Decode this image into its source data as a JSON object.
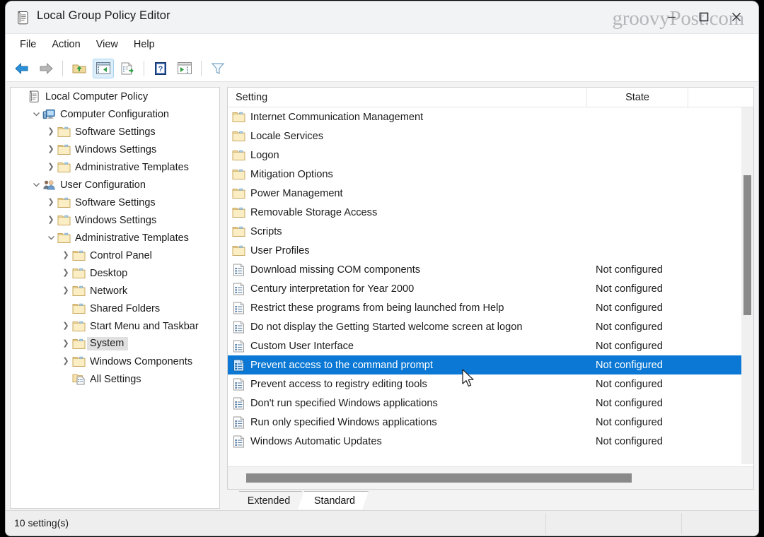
{
  "window": {
    "title": "Local Group Policy Editor",
    "title_icon": "policy-scroll-icon",
    "watermark": "groovyPost.com",
    "controls": {
      "minimize": "minimize-icon",
      "maximize": "maximize-icon",
      "close": "close-icon"
    }
  },
  "menubar": {
    "items": [
      {
        "label": "File"
      },
      {
        "label": "Action"
      },
      {
        "label": "View"
      },
      {
        "label": "Help"
      }
    ]
  },
  "toolbar": {
    "buttons": [
      {
        "name": "back-icon",
        "active": false
      },
      {
        "name": "forward-icon",
        "active": false
      },
      {
        "name": "up-folder-icon",
        "active": false
      },
      {
        "name": "show-tree-icon",
        "active": true
      },
      {
        "name": "export-list-icon",
        "active": false
      },
      {
        "name": "help-icon",
        "active": false
      },
      {
        "name": "show-console-icon",
        "active": false
      },
      {
        "name": "filter-icon",
        "active": false
      }
    ]
  },
  "tree": {
    "items": [
      {
        "label": "Local Computer Policy",
        "indent": 0,
        "twisty": "none",
        "icon": "policy-scroll-icon",
        "selected": false
      },
      {
        "label": "Computer Configuration",
        "indent": 1,
        "twisty": "expanded",
        "icon": "computer-icon",
        "selected": false
      },
      {
        "label": "Software Settings",
        "indent": 2,
        "twisty": "collapsed",
        "icon": "folder-icon",
        "selected": false
      },
      {
        "label": "Windows Settings",
        "indent": 2,
        "twisty": "collapsed",
        "icon": "folder-icon",
        "selected": false
      },
      {
        "label": "Administrative Templates",
        "indent": 2,
        "twisty": "collapsed",
        "icon": "folder-icon",
        "selected": false
      },
      {
        "label": "User Configuration",
        "indent": 1,
        "twisty": "expanded",
        "icon": "user-icon",
        "selected": false
      },
      {
        "label": "Software Settings",
        "indent": 2,
        "twisty": "collapsed",
        "icon": "folder-icon",
        "selected": false
      },
      {
        "label": "Windows Settings",
        "indent": 2,
        "twisty": "collapsed",
        "icon": "folder-icon",
        "selected": false
      },
      {
        "label": "Administrative Templates",
        "indent": 2,
        "twisty": "expanded",
        "icon": "folder-icon",
        "selected": false
      },
      {
        "label": "Control Panel",
        "indent": 3,
        "twisty": "collapsed",
        "icon": "folder-icon",
        "selected": false
      },
      {
        "label": "Desktop",
        "indent": 3,
        "twisty": "collapsed",
        "icon": "folder-icon",
        "selected": false
      },
      {
        "label": "Network",
        "indent": 3,
        "twisty": "collapsed",
        "icon": "folder-icon",
        "selected": false
      },
      {
        "label": "Shared Folders",
        "indent": 3,
        "twisty": "none",
        "icon": "folder-icon",
        "selected": false
      },
      {
        "label": "Start Menu and Taskbar",
        "indent": 3,
        "twisty": "collapsed",
        "icon": "folder-icon",
        "selected": false
      },
      {
        "label": "System",
        "indent": 3,
        "twisty": "collapsed",
        "icon": "folder-icon",
        "selected": true
      },
      {
        "label": "Windows Components",
        "indent": 3,
        "twisty": "collapsed",
        "icon": "folder-icon",
        "selected": false
      },
      {
        "label": "All Settings",
        "indent": 3,
        "twisty": "none",
        "icon": "all-settings-icon",
        "selected": false
      }
    ]
  },
  "list": {
    "columns": [
      {
        "label": "Setting"
      },
      {
        "label": "State"
      },
      {
        "label": ""
      }
    ],
    "rows": [
      {
        "name": "Internet Communication Management",
        "state": "",
        "icon": "folder-icon",
        "selected": false
      },
      {
        "name": "Locale Services",
        "state": "",
        "icon": "folder-icon",
        "selected": false
      },
      {
        "name": "Logon",
        "state": "",
        "icon": "folder-icon",
        "selected": false
      },
      {
        "name": "Mitigation Options",
        "state": "",
        "icon": "folder-icon",
        "selected": false
      },
      {
        "name": "Power Management",
        "state": "",
        "icon": "folder-icon",
        "selected": false
      },
      {
        "name": "Removable Storage Access",
        "state": "",
        "icon": "folder-icon",
        "selected": false
      },
      {
        "name": "Scripts",
        "state": "",
        "icon": "folder-icon",
        "selected": false
      },
      {
        "name": "User Profiles",
        "state": "",
        "icon": "folder-icon",
        "selected": false
      },
      {
        "name": "Download missing COM components",
        "state": "Not configured",
        "icon": "policy-setting-icon",
        "selected": false
      },
      {
        "name": "Century interpretation for Year 2000",
        "state": "Not configured",
        "icon": "policy-setting-icon",
        "selected": false
      },
      {
        "name": "Restrict these programs from being launched from Help",
        "state": "Not configured",
        "icon": "policy-setting-icon",
        "selected": false
      },
      {
        "name": "Do not display the Getting Started welcome screen at logon",
        "state": "Not configured",
        "icon": "policy-setting-icon",
        "selected": false
      },
      {
        "name": "Custom User Interface",
        "state": "Not configured",
        "icon": "policy-setting-icon",
        "selected": false
      },
      {
        "name": "Prevent access to the command prompt",
        "state": "Not configured",
        "icon": "policy-setting-icon",
        "selected": true
      },
      {
        "name": "Prevent access to registry editing tools",
        "state": "Not configured",
        "icon": "policy-setting-icon",
        "selected": false
      },
      {
        "name": "Don't run specified Windows applications",
        "state": "Not configured",
        "icon": "policy-setting-icon",
        "selected": false
      },
      {
        "name": "Run only specified Windows applications",
        "state": "Not configured",
        "icon": "policy-setting-icon",
        "selected": false
      },
      {
        "name": "Windows Automatic Updates",
        "state": "Not configured",
        "icon": "policy-setting-icon",
        "selected": false
      }
    ]
  },
  "tabs": [
    {
      "label": "Extended",
      "active": false
    },
    {
      "label": "Standard",
      "active": true
    }
  ],
  "statusbar": {
    "text": "10 setting(s)"
  },
  "colors": {
    "selection": "#0a78d4",
    "window_bg": "#f3f3f3",
    "pane_bg": "#ffffff",
    "folder": "#f5dfa4",
    "scrollbar_thumb": "#8a8a8a"
  }
}
